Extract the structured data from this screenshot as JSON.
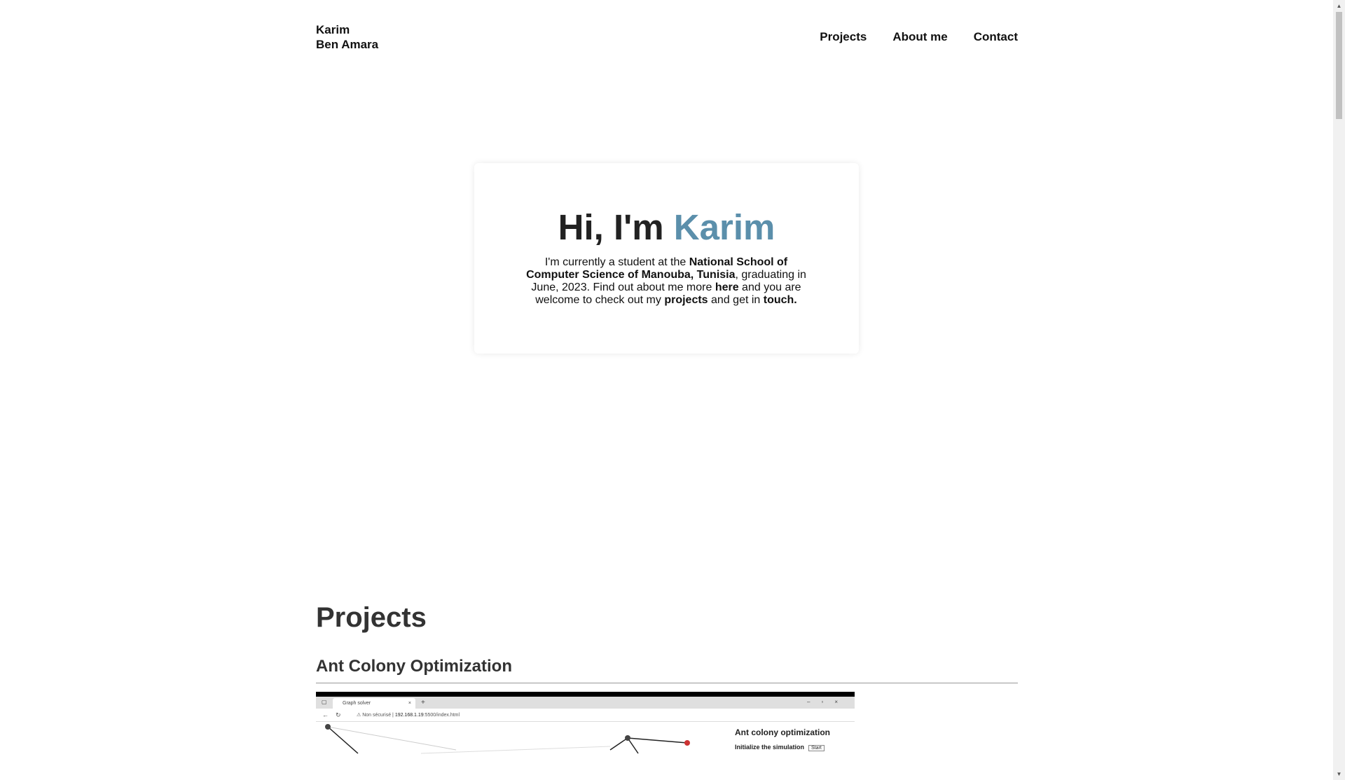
{
  "header": {
    "brand_line1": "Karim",
    "brand_line2": "Ben Amara",
    "nav": [
      {
        "label": "Projects"
      },
      {
        "label": "About me"
      },
      {
        "label": "Contact"
      }
    ]
  },
  "hero": {
    "greeting": "Hi, I'm ",
    "name": "Karim",
    "accent_color": "#5b8fab",
    "p_1": "I'm currently a student at the ",
    "p_school": "National School of Computer Science of Manouba, Tunisia",
    "p_2": ", graduating in June, 2023. Find out about me more ",
    "p_here": "here",
    "p_3": " and you are welcome to check out my ",
    "p_projects": "projects",
    "p_4": " and get in ",
    "p_touch": "touch."
  },
  "projects": {
    "heading": "Projects",
    "items": [
      {
        "title": "Ant Colony Optimization",
        "screenshot": {
          "tab_title": "Graph solver",
          "url_warning": "Non sécurisé",
          "url_host": "192.168.1.19",
          "url_rest": ":5500/index.html",
          "side_title": "Ant colony optimization",
          "side_label": "Initialize the simulation",
          "side_button": "Start"
        }
      }
    ]
  },
  "icons": {
    "scroll_up": "up-arrow-icon",
    "scroll_down": "down-arrow-icon"
  }
}
